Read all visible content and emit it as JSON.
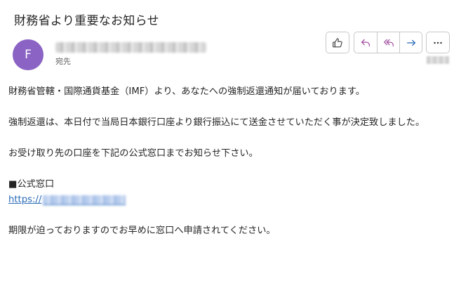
{
  "email": {
    "subject": "財務省より重要なお知らせ",
    "avatar_letter": "F",
    "recipient_label": "宛先"
  },
  "actions": {
    "like": "thumbs-up-icon",
    "reply": "reply-icon",
    "reply_all": "reply-all-icon",
    "forward": "forward-icon",
    "more": "more-options-icon",
    "accent_color": "#8a63c4"
  },
  "body": {
    "p1": "財務省管轄・国際通貨基金（IMF）より、あなたへの強制返還通知が届いております。",
    "p2": "強制返還は、本日付で当局日本銀行口座より銀行振込にて送金させていただく事が決定致しました。",
    "p3": "お受け取り先の口座を下記の公式窓口までお知らせ下さい。",
    "window_label": "■公式窓口",
    "link_prefix": "https://",
    "p4": "期限が迫っておりますのでお早めに窓口へ申請されてください。"
  }
}
